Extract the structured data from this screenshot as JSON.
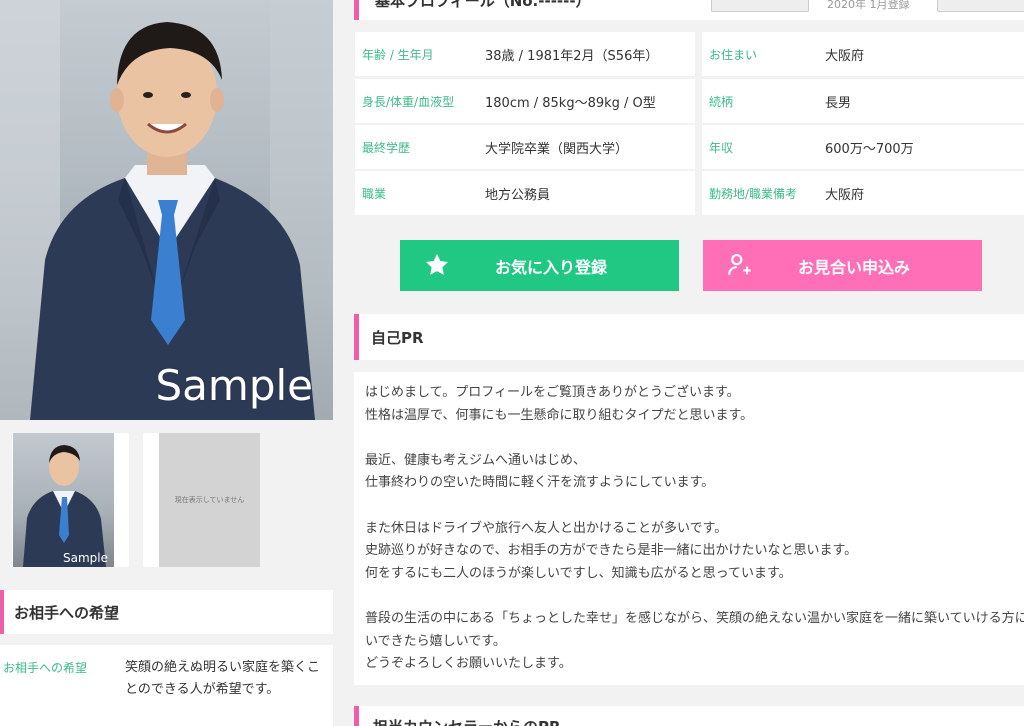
{
  "header": {
    "cut_title": "基本プロフィール（No.------）",
    "meta_text": "2020年 1月登録"
  },
  "photo": {
    "watermark": "Sample",
    "thumb_watermark": "Sample",
    "placeholder_text": "現在表示していません"
  },
  "profile": {
    "rows": [
      {
        "label": "年齢 / 生年月",
        "value": "38歳 / 1981年2月（S56年）"
      },
      {
        "label": "身長/体重/血液型",
        "value": "180cm / 85kg〜89kg / O型"
      },
      {
        "label": "最終学歴",
        "value": "大学院卒業（関西大学）"
      },
      {
        "label": "職業",
        "value": "地方公務員"
      }
    ],
    "rows_right": [
      {
        "label": "お住まい",
        "value": "大阪府"
      },
      {
        "label": "続柄",
        "value": "長男"
      },
      {
        "label": "年収",
        "value": "600万〜700万"
      },
      {
        "label": "勤務地/職業備考",
        "value": "大阪府"
      }
    ]
  },
  "actions": {
    "favorite_label": "お気に入り登録",
    "favorite_icon": "star-icon",
    "meet_label": "お見合い申込み",
    "meet_icon": "person-add-icon",
    "favorite_color": "#20c884",
    "meet_color": "#ff6fb8"
  },
  "pr": {
    "title": "自己PR",
    "text": "はじめまして。プロフィールをご覧頂きありがとうございます。\n性格は温厚で、何事にも一生懸命に取り組むタイプだと思います。\n\n最近、健康も考えジムへ通いはじめ、\n仕事終わりの空いた時間に軽く汗を流すようにしています。\n\nまた休日はドライブや旅行へ友人と出かけることが多いです。\n史跡巡りが好きなので、お相手の方ができたら是非一緒に出かけたいなと思います。\n何をするにも二人のほうが楽しいですし、知識も広がると思っています。\n\n普段の生活の中にある「ちょっとした幸せ」を感じながら、笑顔の絶えない温かい家庭を一緒に築いていける方にお会いできたら嬉しいです。\nどうぞよろしくお願いいたします。"
  },
  "wish": {
    "title": "お相手への希望",
    "label": "お相手への希望",
    "text": "笑顔の絶えぬ明るい家庭を築くことのできる人が希望です。"
  },
  "next_section": {
    "title": "担当カウンセラーからのPR"
  },
  "colors": {
    "accent_pink": "#ef5fa7",
    "label_green": "#3dbb88"
  }
}
